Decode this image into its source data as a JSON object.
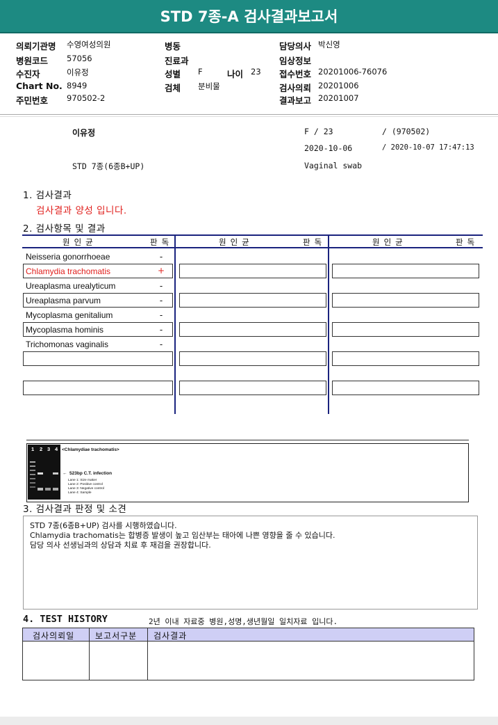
{
  "header": {
    "title": "STD 7종-A 검사결과보고서"
  },
  "info": {
    "institution_label": "의뢰기관명",
    "institution_value": "수영여성의원",
    "hospital_code_label": "병원코드",
    "hospital_code_value": "57056",
    "patient_label": "수진자",
    "patient_value": "이유정",
    "chart_label": "Chart No.",
    "chart_value": "8949",
    "resident_label": "주민번호",
    "resident_value": "970502-2",
    "ward_label": "병동",
    "dept_label": "진료과",
    "sex_label": "성별",
    "sex_value": "F",
    "age_label": "나이",
    "age_value": "23",
    "specimen_label": "검체",
    "specimen_value": "분비물",
    "doctor_label": "담당의사",
    "doctor_value": "박신영",
    "clinical_label": "임상정보",
    "receipt_label": "접수번호",
    "receipt_value": "20201006-76076",
    "request_label": "검사의뢰",
    "request_value": "20201006",
    "report_label": "결과보고",
    "report_value": "20201007"
  },
  "summary": {
    "name": "이유정",
    "sex_age": "F  /  23",
    "birth": "/ (970502)",
    "date": "2020-10-06",
    "datetime": "/ 2020-10-07 17:47:13",
    "test_name": "STD 7종(6종B+UP)",
    "specimen": "Vaginal swab"
  },
  "section1": {
    "title": "1. 검사결과",
    "message": "검사결과 양성 입니다."
  },
  "section2": {
    "title": "2. 검사항목 및 결과",
    "col_pathogen": "원인균",
    "col_result": "판독",
    "rows": [
      {
        "name": "Neisseria gonorrhoeae",
        "result": "-"
      },
      {
        "name": "Chlamydia trachomatis",
        "result": "+"
      },
      {
        "name": "Ureaplasma urealyticum",
        "result": "-"
      },
      {
        "name": "Ureaplasma parvum",
        "result": "-"
      },
      {
        "name": "Mycoplasma genitalium",
        "result": "-"
      },
      {
        "name": "Mycoplasma hominis",
        "result": "-"
      },
      {
        "name": "Trichomonas vaginalis",
        "result": "-"
      }
    ]
  },
  "gel": {
    "lanes": [
      "1",
      "2",
      "3",
      "4"
    ],
    "title": "<Chlamydiae trachomatis>",
    "band_label": "523bp C.T. infection",
    "legend": [
      "Lane 1: Size maker",
      "Lane 2: Positive control",
      "Lane 3: Negative control",
      "Lane 4: Sample"
    ]
  },
  "section3": {
    "title": "3. 검사결과 판정 및 소견",
    "lines": [
      "STD 7종(6종B+UP) 검사를 시행하였습니다.",
      "Chlamydia trachomatis는 합병증 발생이 높고 임산부는 태아에 나쁜 영향을 줄 수 있습니다.",
      "담당 의사 선생님과의 상담과 치료 후 재검을 권장합니다."
    ]
  },
  "section4": {
    "title": "4. TEST HISTORY",
    "note": "2년 이내 자료중 병원,성명,생년월일 일치자료 입니다.",
    "headers": [
      "검사의뢰일",
      "보고서구분",
      "검사결과"
    ]
  },
  "colors": {
    "header": "#1d8a82",
    "positive": "#e0201d",
    "table_rule": "#1a237e",
    "history_head": "#cfcff5"
  }
}
